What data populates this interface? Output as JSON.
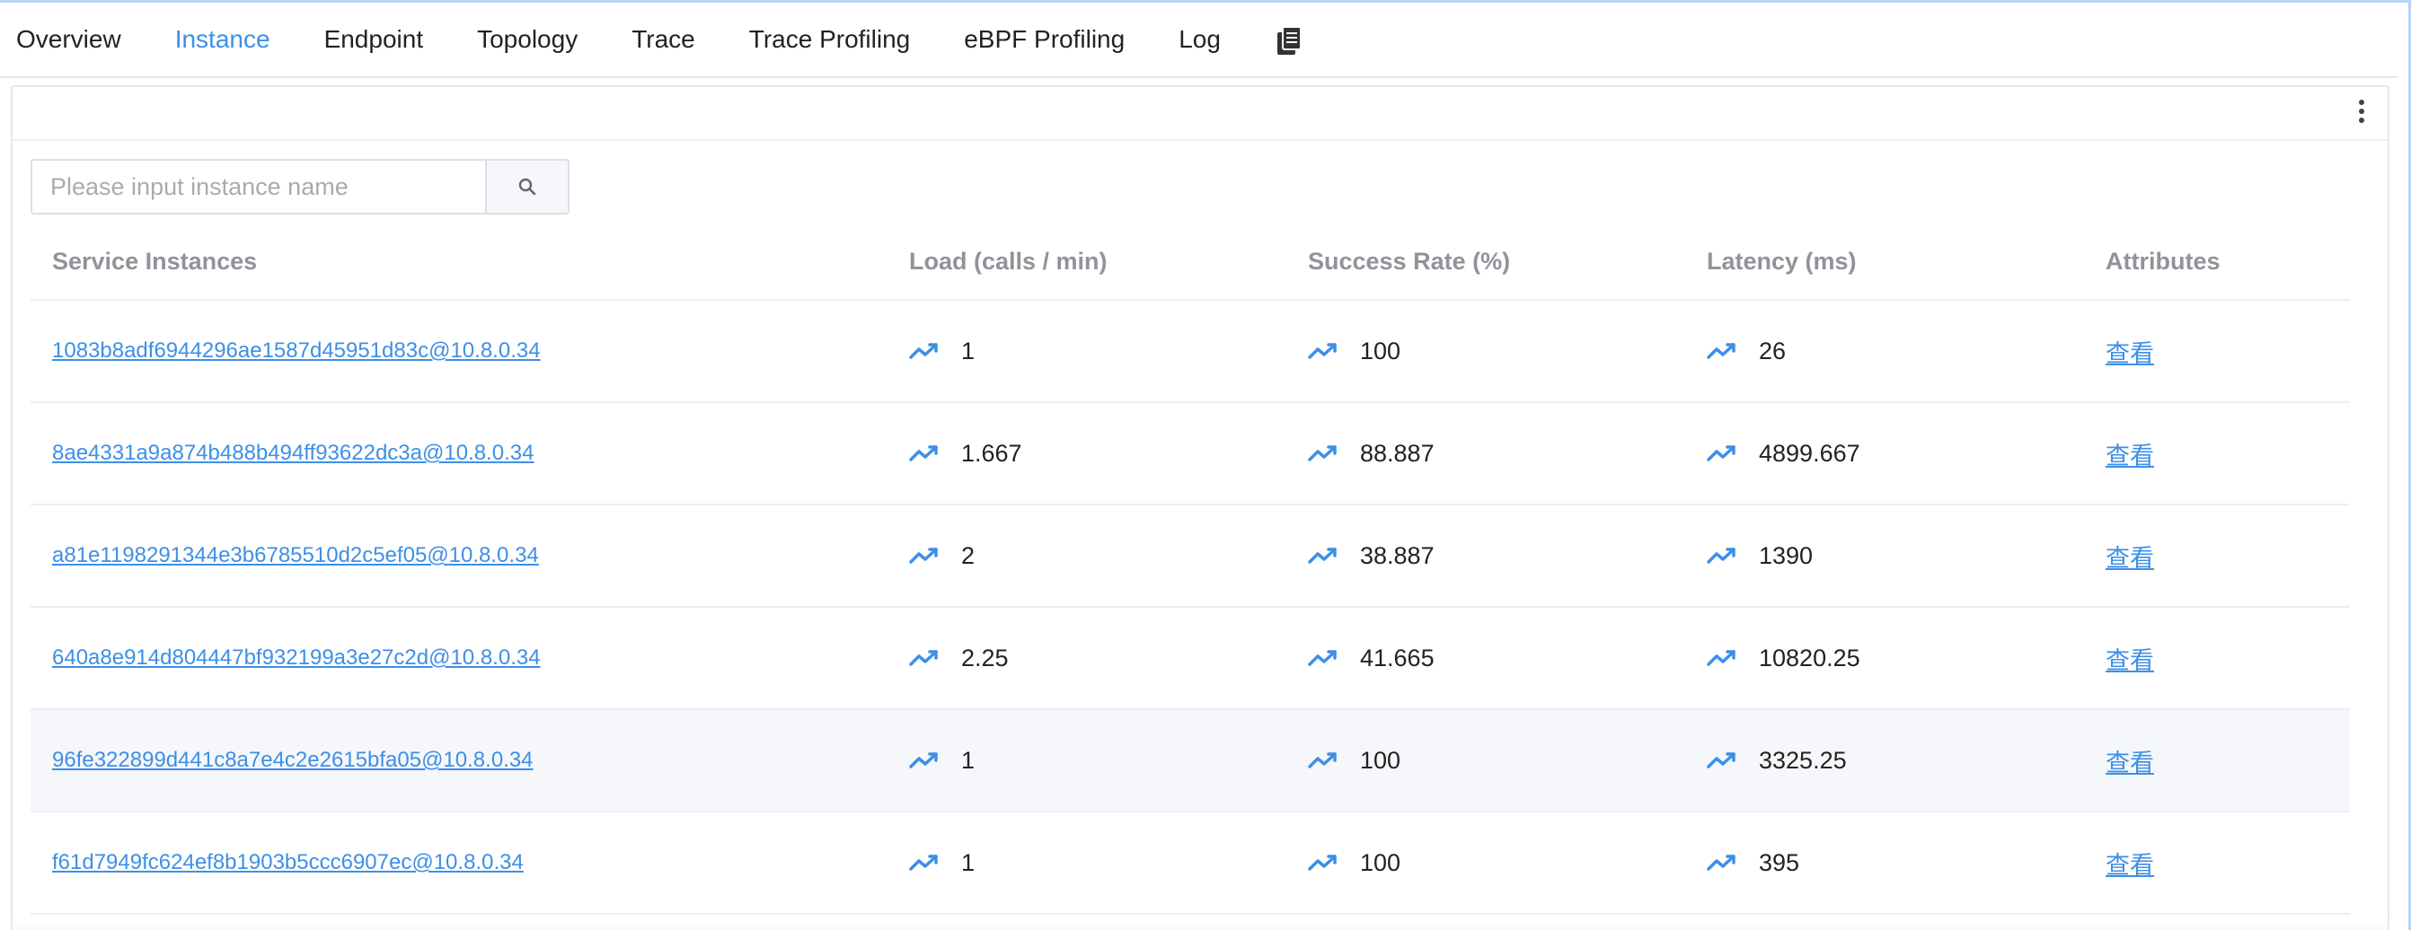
{
  "tabs": [
    {
      "label": "Overview"
    },
    {
      "label": "Instance"
    },
    {
      "label": "Endpoint"
    },
    {
      "label": "Topology"
    },
    {
      "label": "Trace"
    },
    {
      "label": "Trace Profiling"
    },
    {
      "label": "eBPF Profiling"
    },
    {
      "label": "Log"
    }
  ],
  "active_tab": "Instance",
  "tab_extra_icon": "copy-icon",
  "search": {
    "placeholder": "Please input instance name",
    "value": "",
    "icon": "search-icon"
  },
  "table": {
    "headers": {
      "name": "Service Instances",
      "load": "Load (calls / min)",
      "success": "Success Rate (%)",
      "latency": "Latency (ms)",
      "attributes": "Attributes"
    },
    "trend_icon": "trend-line-icon",
    "rows": [
      {
        "name": "1083b8adf6944296ae1587d45951d83c@10.8.0.34",
        "load": "1",
        "success": "100",
        "latency": "26",
        "attributes": "查看"
      },
      {
        "name": "8ae4331a9a874b488b494ff93622dc3a@10.8.0.34",
        "load": "1.667",
        "success": "88.887",
        "latency": "4899.667",
        "attributes": "查看"
      },
      {
        "name": "a81e1198291344e3b6785510d2c5ef05@10.8.0.34",
        "load": "2",
        "success": "38.887",
        "latency": "1390",
        "attributes": "查看"
      },
      {
        "name": "640a8e914d804447bf932199a3e27c2d@10.8.0.34",
        "load": "2.25",
        "success": "41.665",
        "latency": "10820.25",
        "attributes": "查看"
      },
      {
        "name": "96fe322899d441c8a7e4c2e2615bfa05@10.8.0.34",
        "load": "1",
        "success": "100",
        "latency": "3325.25",
        "attributes": "查看"
      },
      {
        "name": "f61d7949fc624ef8b1903b5ccc6907ec@10.8.0.34",
        "load": "1",
        "success": "100",
        "latency": "395",
        "attributes": "查看"
      }
    ]
  },
  "colors": {
    "accent": "#3d8fe6",
    "header_text": "#909399",
    "row_hover": "#f5f7fa"
  }
}
